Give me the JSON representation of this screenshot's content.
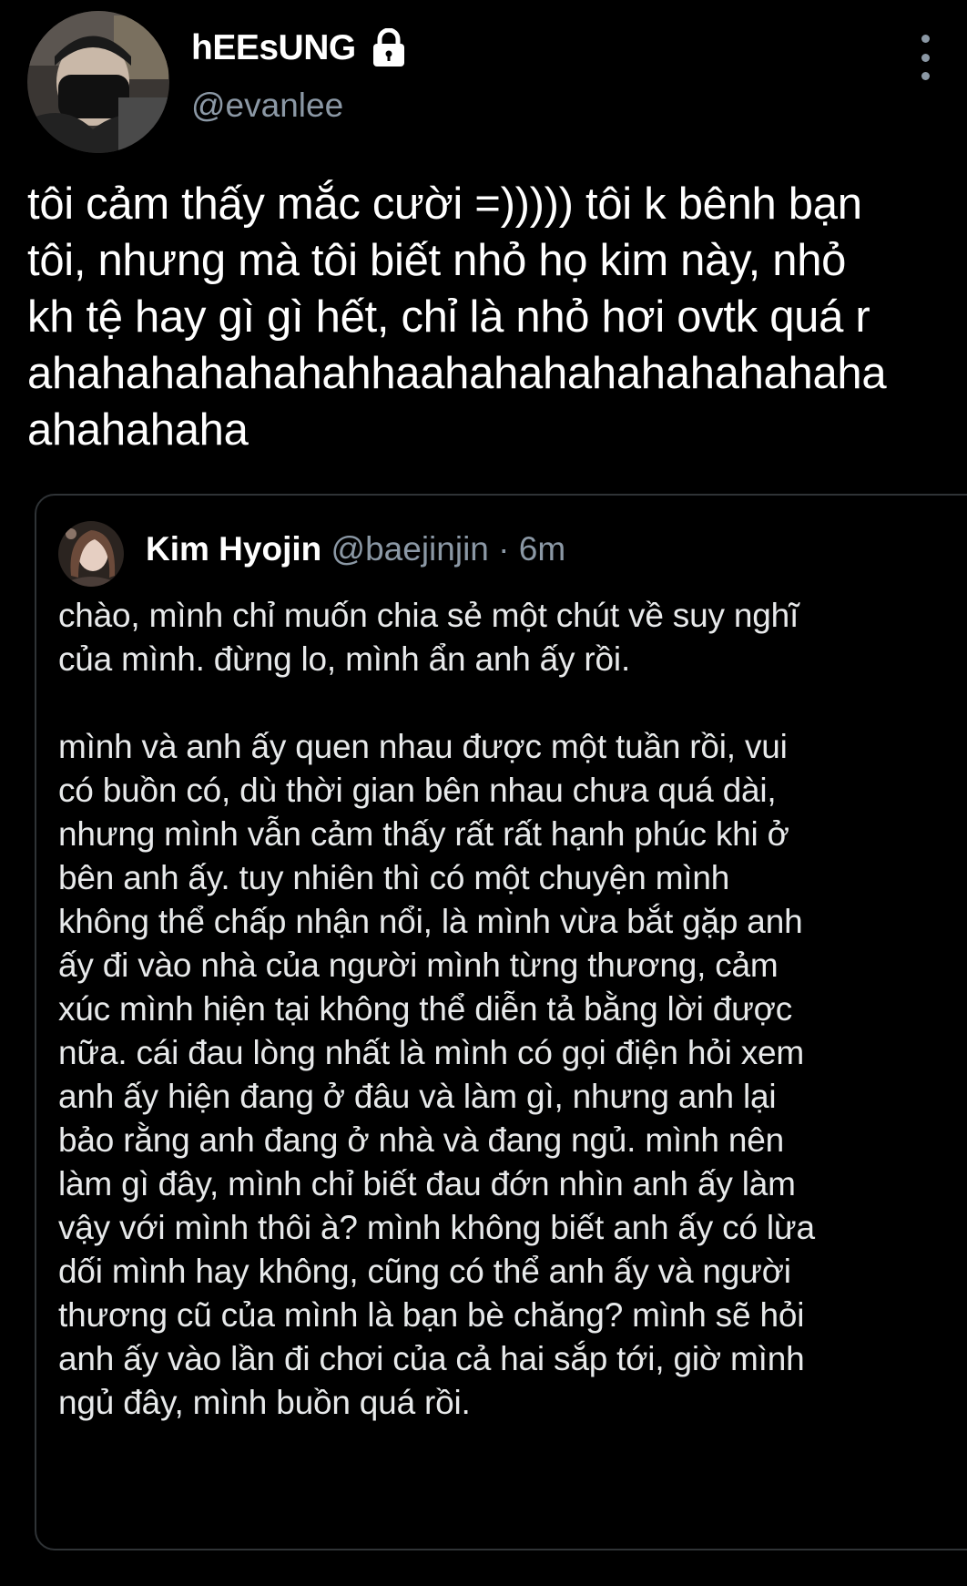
{
  "author": {
    "display_name": "hEEsUNG",
    "handle": "@evanlee",
    "avatar_icon": "user-avatar-masked-selfie",
    "lock_icon": "lock-icon"
  },
  "menu": {
    "icon": "more-vertical-icon"
  },
  "tweet": {
    "text": "tôi cảm thấy mắc cười =))))) tôi k bênh bạn\ntôi, nhưng mà tôi biết nhỏ họ kim này, nhỏ\nkh tệ hay gì gì hết, chỉ là nhỏ hơi ovtk quá r\nahahahahahahahhaahahahahahahahahaha\nahahahaha"
  },
  "quoted_tweet": {
    "display_name": "Kim Hyojin",
    "handle": "@baejinjin",
    "separator": " · ",
    "time": "6m",
    "avatar_icon": "user-avatar-photo",
    "text": "chào, mình chỉ muốn chia sẻ một chút về suy nghĩ\ncủa mình. đừng lo, mình ẩn anh ấy rồi.\n\nmình và anh ấy quen nhau được một tuần rồi, vui\ncó buồn có, dù thời gian bên nhau chưa quá dài,\nnhưng mình vẫn cảm thấy rất rất hạnh phúc khi ở\nbên anh ấy. tuy nhiên thì có một chuyện mình\nkhông thể chấp nhận nổi, là mình vừa bắt gặp anh\nấy đi vào nhà của người mình từng thương, cảm\nxúc mình hiện tại không thể diễn tả bằng lời được\nnữa. cái đau lòng nhất là mình có gọi điện hỏi xem\nanh ấy hiện đang ở đâu và làm gì, nhưng anh lại\nbảo rằng anh đang ở nhà và đang ngủ. mình nên\nlàm gì đây, mình chỉ biết đau đớn nhìn anh ấy làm\nvậy với mình thôi à? mình không biết anh ấy có lừa\ndối mình hay không, cũng có thể anh ấy và người\nthương cũ của mình là bạn bè chăng? mình sẽ hỏi\nanh ấy vào lần đi chơi của cả hai sắp tới, giờ mình\nngủ đây, mình buồn quá rồi."
  },
  "colors": {
    "background": "#000000",
    "primary_text": "#ffffff",
    "secondary_text": "#8b98a5",
    "border": "#2f3336"
  }
}
